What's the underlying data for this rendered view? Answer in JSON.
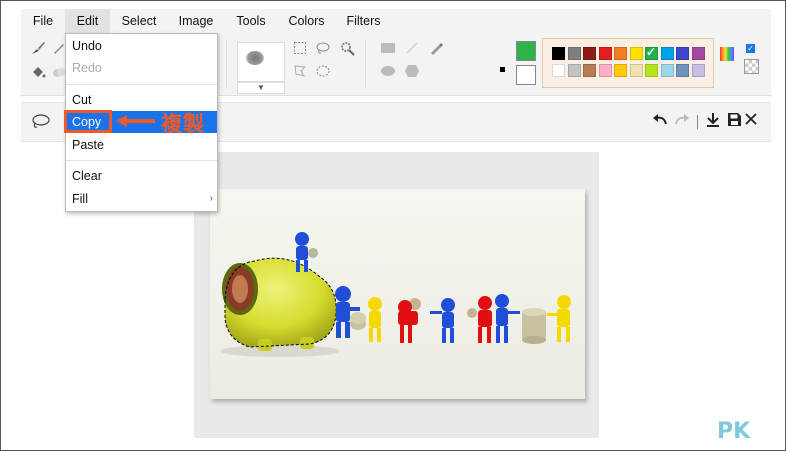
{
  "menubar": {
    "items": [
      {
        "label": "File"
      },
      {
        "label": "Edit"
      },
      {
        "label": "Select"
      },
      {
        "label": "Image"
      },
      {
        "label": "Tools"
      },
      {
        "label": "Colors"
      },
      {
        "label": "Filters"
      }
    ],
    "active": "Edit"
  },
  "edit_menu": {
    "items": [
      {
        "label": "Undo",
        "enabled": true
      },
      {
        "label": "Redo",
        "enabled": false
      },
      {
        "label": "Cut",
        "enabled": true
      },
      {
        "label": "Copy",
        "enabled": true,
        "selected": true
      },
      {
        "label": "Paste",
        "enabled": true
      },
      {
        "label": "Clear",
        "enabled": true
      },
      {
        "label": "Fill",
        "enabled": true,
        "submenu": true
      }
    ],
    "submenu_arrow": "›"
  },
  "annotation": {
    "label": "複製",
    "color": "#f05a28"
  },
  "colors": {
    "primary": "#2db34a",
    "secondary": "#ffffff",
    "accent": "#1a73e8",
    "palette_row1": [
      "#000000",
      "#7f7f7f",
      "#8b1a1a",
      "#e02020",
      "#f47f20",
      "#ffe000",
      "#22b14c",
      "#00a2e8",
      "#3f48cc",
      "#a349a4"
    ],
    "palette_row2": [
      "#ffffff",
      "#c3c3c3",
      "#b97a57",
      "#ffaec9",
      "#ffc90e",
      "#efe4b0",
      "#b5e61d",
      "#99d9ea",
      "#7092be",
      "#c8bfe7"
    ],
    "checked_swatch_index": 6
  },
  "toolbar": {
    "options_icons": [
      "lasso-icon"
    ],
    "right_icons": [
      "undo-icon",
      "redo-icon",
      "download-icon",
      "save-icon",
      "close-icon"
    ]
  },
  "watermark": {
    "text": "PK"
  }
}
